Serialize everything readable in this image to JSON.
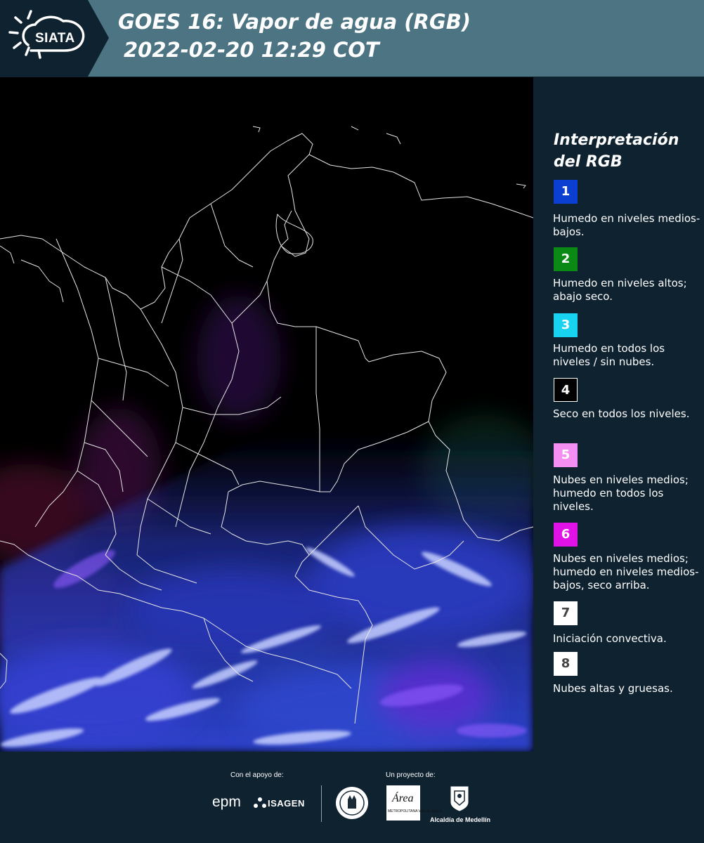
{
  "header": {
    "logo_text": "SIATA",
    "title_line1": "GOES 16: Vapor de agua (RGB)",
    "title_line2": "2022-02-20 12:29 COT"
  },
  "legend": {
    "title": "Interpretación del RGB",
    "items": [
      {
        "number": "1",
        "color": "#0b3fd1",
        "text": "Humedo en niveles medios-bajos."
      },
      {
        "number": "2",
        "color": "#0a8a14",
        "text": "Humedo en niveles altos; abajo seco."
      },
      {
        "number": "3",
        "color": "#17d3f0",
        "text": "Humedo en todos los niveles / sin nubes."
      },
      {
        "number": "4",
        "color": "#000000",
        "text": "Seco en todos los niveles."
      },
      {
        "number": "5",
        "color": "#f48ef2",
        "text": "Nubes en niveles medios; humedo en todos los niveles."
      },
      {
        "number": "6",
        "color": "#e012e8",
        "text": "Nubes en niveles medios; humedo en niveles medios-bajos, seco arriba."
      },
      {
        "number": "7",
        "color": "#ffffff",
        "text": "Iniciación convectiva."
      },
      {
        "number": "8",
        "color": "#ffffff",
        "text": "Nubes altas y gruesas."
      }
    ]
  },
  "footer": {
    "support_label": "Con el apoyo de:",
    "project_label": "Un proyecto de:",
    "epm": "epm",
    "isagen": "ISAGEN",
    "area_logo_text": "Área",
    "area_logo_sub": "METROPOLITANA Valle de Aburrá",
    "alcaldia": "Alcaldía de Medellín"
  },
  "colors": {
    "header_bg": "#4c7482",
    "panel_bg": "#0f2230",
    "map_bg": "#000000"
  }
}
